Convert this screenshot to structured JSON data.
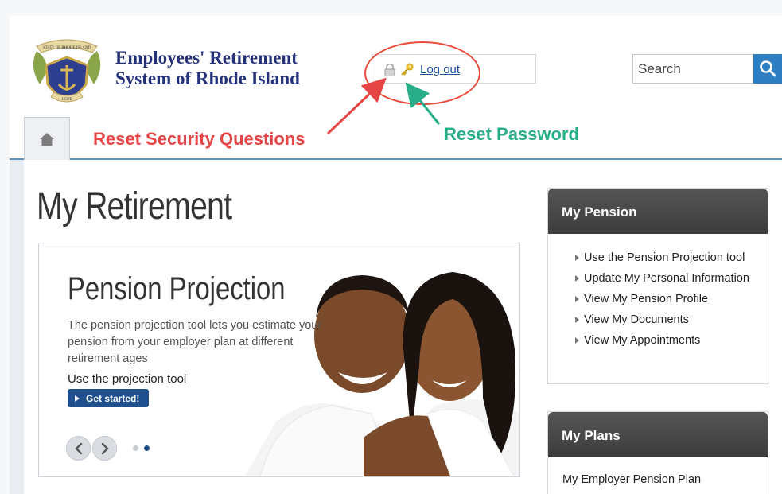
{
  "header": {
    "org_name_line1": "Employees' Retirement",
    "org_name_line2": "System of Rhode Island",
    "logo_top_text": "STATE OF RHODE ISLAND",
    "logo_bottom_text": "HOPE",
    "logout_label": "Log out",
    "search_placeholder": "Search"
  },
  "annotations": {
    "reset_security": "Reset Security Questions",
    "reset_password": "Reset Password"
  },
  "main": {
    "page_title": "My Retirement",
    "carousel": {
      "title": "Pension Projection",
      "description": "The pension projection tool lets you estimate your pension from your employer plan at different retirement ages",
      "cta_label": "Use the projection tool",
      "button_label": "Get started!",
      "active_slide": 2,
      "slide_count": 2
    }
  },
  "sidebar": {
    "pension": {
      "title": "My Pension",
      "links": [
        "Use the Pension Projection tool",
        "Update My Personal Information",
        "View My Pension Profile",
        "View My Documents",
        "View My Appointments"
      ]
    },
    "plans": {
      "title": "My Plans",
      "items": [
        "My Employer Pension Plan"
      ]
    }
  },
  "colors": {
    "brand_navy": "#25327a",
    "link_blue": "#1d4f9b",
    "search_blue": "#2d7fc1",
    "annotation_red": "#e54545",
    "annotation_green": "#27ae88"
  }
}
